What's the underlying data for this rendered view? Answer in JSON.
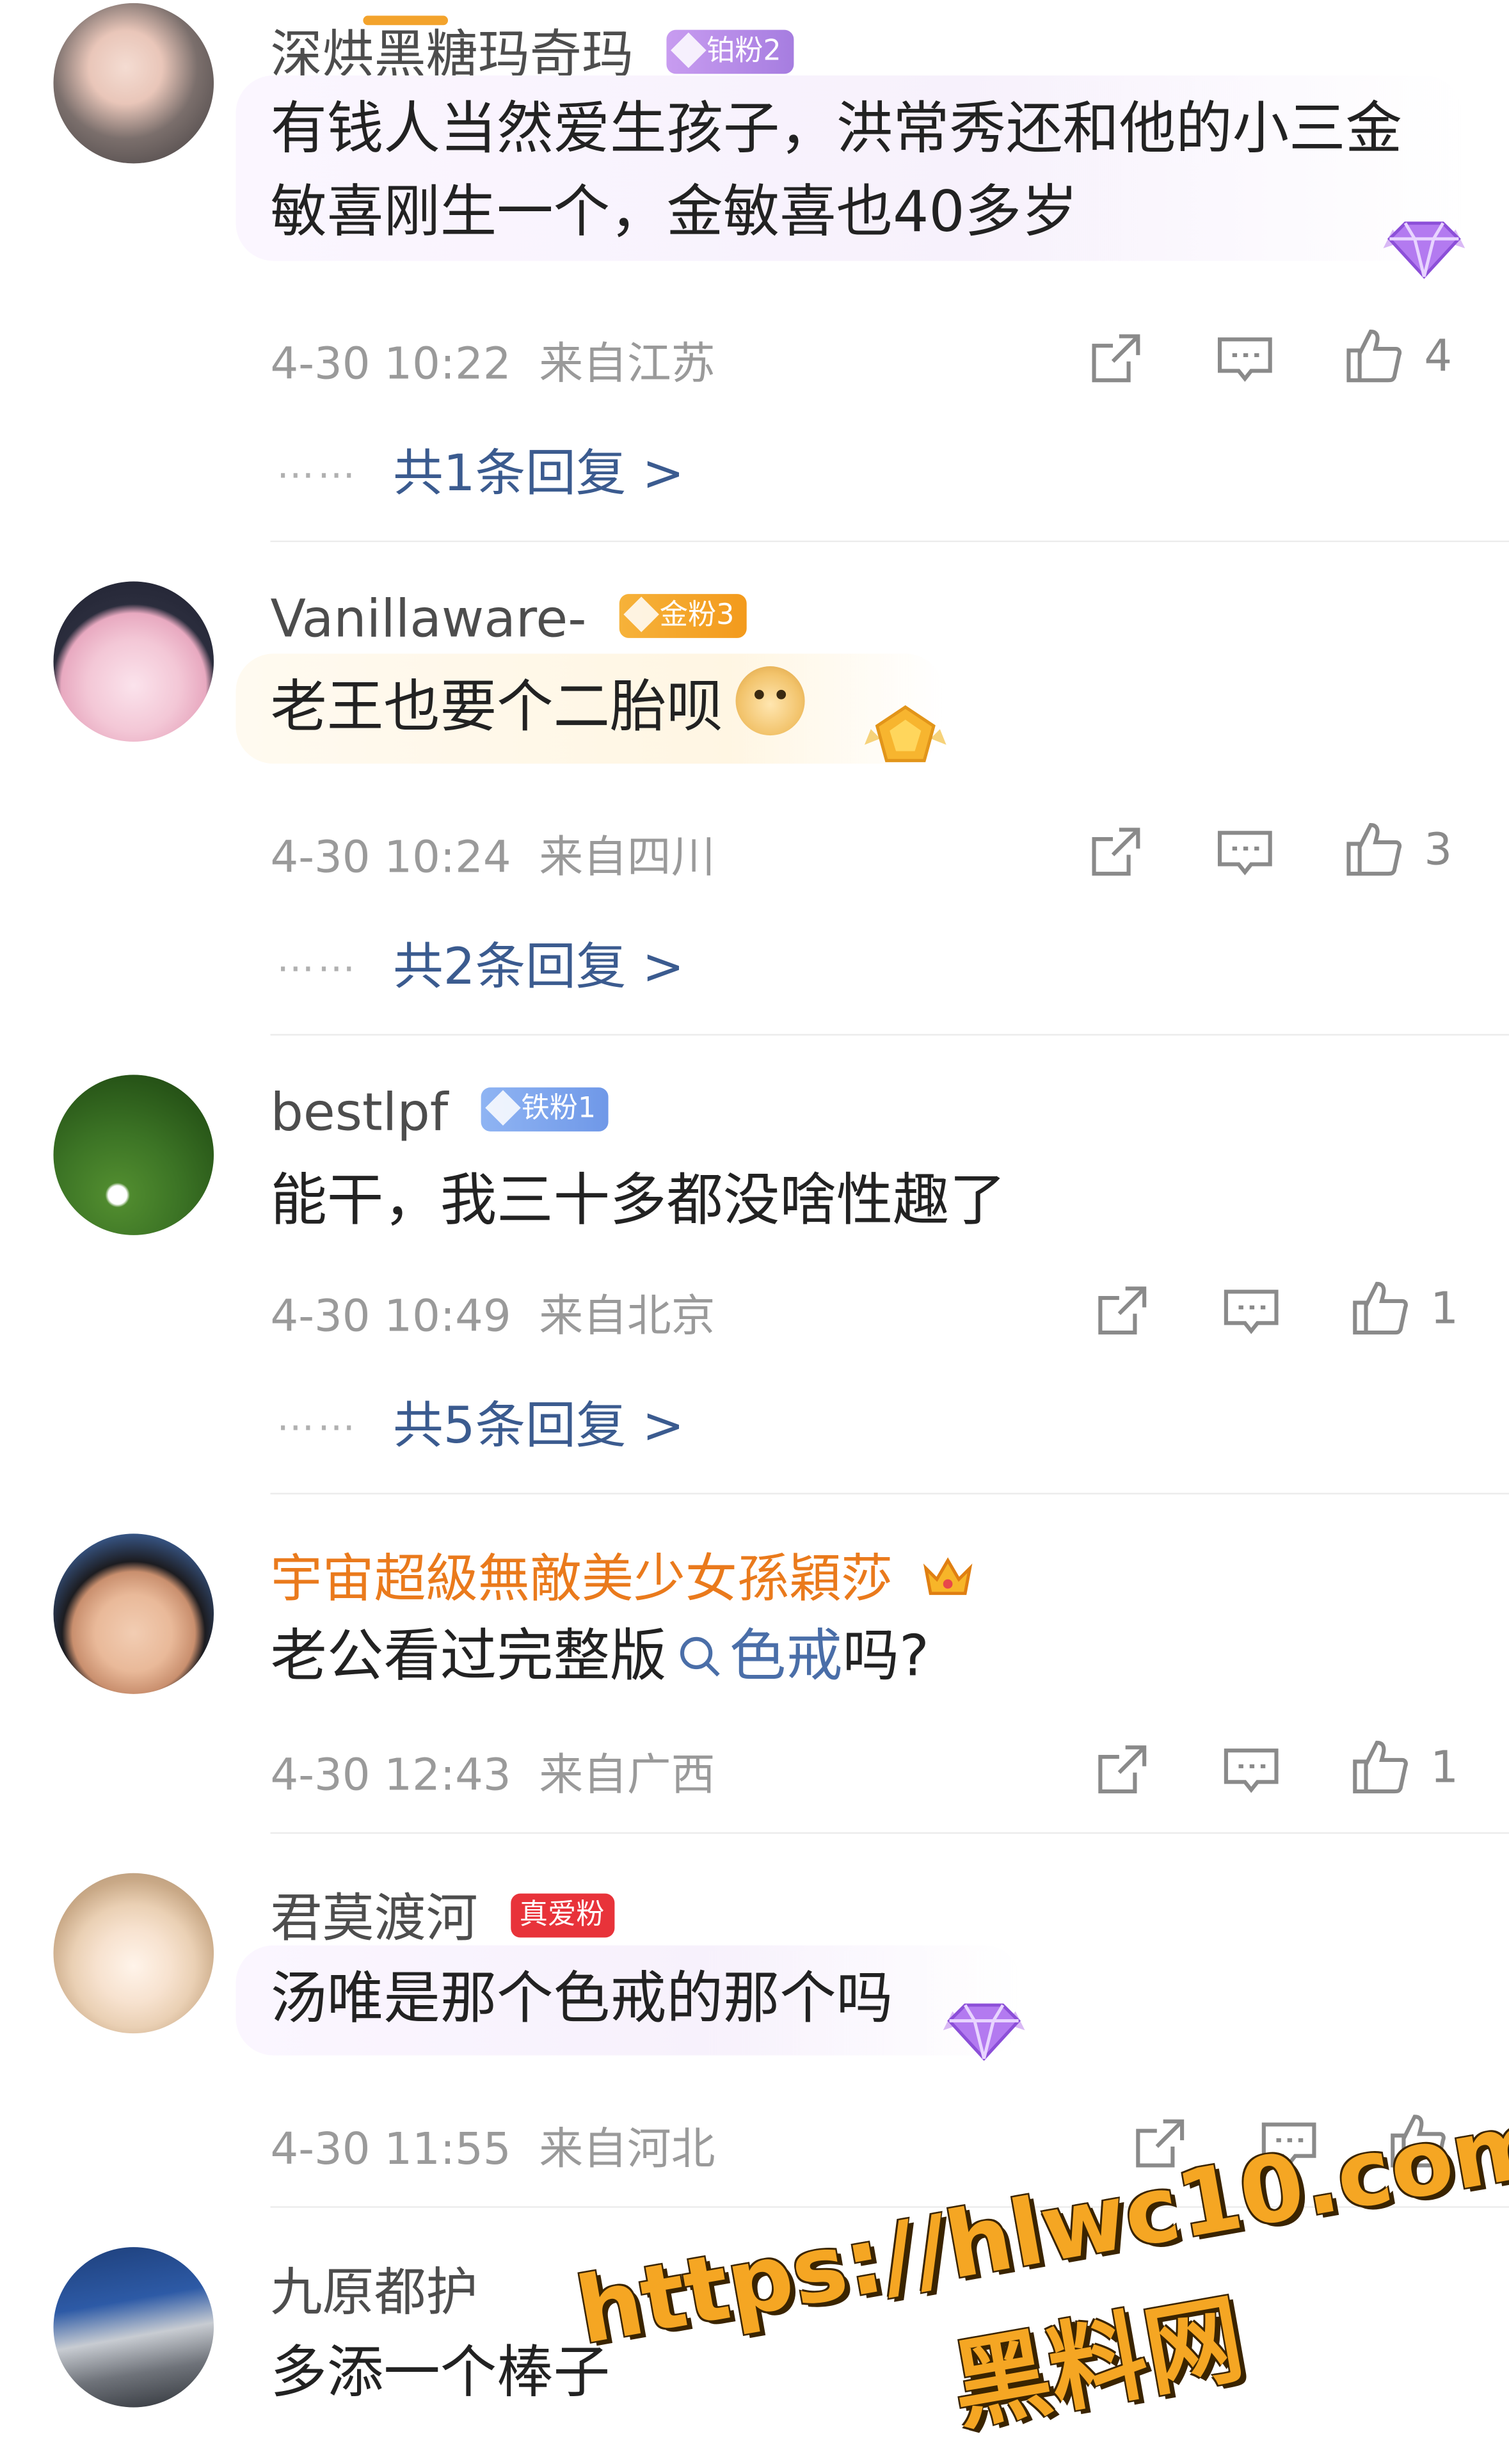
{
  "colors": {
    "accent": "#3b5b8f",
    "vip_name": "#ea7a1c",
    "watermark": "#f5a623"
  },
  "comments": [
    {
      "username": "深烘黑糖玛奇玛",
      "badge": "铂粉2",
      "text_lines": [
        "有钱人当然爱生孩子，洪常秀还和他的小三金",
        "敏喜刚生一个，金敏喜也40多岁"
      ],
      "time": "4-30 10:22",
      "location": "来自江苏",
      "likes": "4",
      "dots": "……",
      "replies": "共1条回复 >"
    },
    {
      "username": "Vanillaware-",
      "badge": "金粉3",
      "text": "老王也要个二胎呗",
      "time": "4-30 10:24",
      "location": "来自四川",
      "likes": "3",
      "dots": "……",
      "replies": "共2条回复 >"
    },
    {
      "username": "bestlpf",
      "badge": "铁粉1",
      "text": "能干，我三十多都没啥性趣了",
      "time": "4-30 10:49",
      "location": "来自北京",
      "likes": "1",
      "dots": "……",
      "replies": "共5条回复 >"
    },
    {
      "username": "宇宙超級無敵美少女孫穎莎",
      "text_before": "老公看过完整版",
      "link": "色戒",
      "text_after": "吗?",
      "time": "4-30 12:43",
      "location": "来自广西",
      "likes": "1"
    },
    {
      "username": "君莫渡河",
      "badge": "真爱粉",
      "text": "汤唯是那个色戒的那个吗",
      "time": "4-30 11:55",
      "location": "来自河北"
    },
    {
      "username": "九原都护",
      "text": "多添一个棒子"
    }
  ],
  "watermark": {
    "url": "https://hlwc10.com",
    "site": "黑料网"
  }
}
